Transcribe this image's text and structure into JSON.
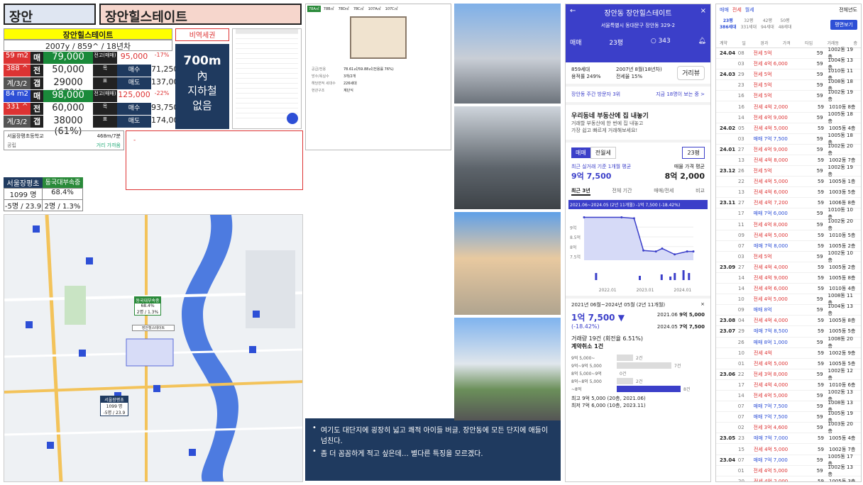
{
  "header": {
    "region": "장안",
    "apt": "장안힐스테이트"
  },
  "card": {
    "name": "장안힐스테이트",
    "meta": "2007y / 859^ / 18년차",
    "tag_label": "비역세권"
  },
  "rows": [
    {
      "a": "59 m2",
      "b": "매",
      "c": "79,000",
      "d": "전고(매매)",
      "e": "95,000",
      "f": "-17%"
    },
    {
      "a": "388 ^",
      "b": "전",
      "c": "50,000",
      "d": "목",
      "e": "매수",
      "f": "71,250"
    },
    {
      "a": "계/3/2",
      "b": "갭",
      "c": "29000 (63%)",
      "d": "표",
      "e": "매도",
      "f": "137,000"
    },
    {
      "a": "84 m2",
      "b": "매",
      "c": "98,000",
      "d": "전고(매매)",
      "e": "125,000",
      "f": "-22%"
    },
    {
      "a": "331 ^",
      "b": "전",
      "c": "60,000",
      "d": "목",
      "e": "매수",
      "f": "93,750"
    },
    {
      "a": "계/3/2",
      "b": "갭",
      "c": "38000 (61%)",
      "d": "표",
      "e": "매도",
      "f": "174,000"
    }
  ],
  "subway": {
    "l1": "700m",
    "l2": "內",
    "l3": "지하철",
    "l4": "없음"
  },
  "school": {
    "name": "서울장평초등학교",
    "dist": "468m/7분",
    "type": "공립",
    "note": "거리 가까움"
  },
  "stats": {
    "h1": "서울장평초",
    "h2": "동국대부속중",
    "v1": "1099 명",
    "v2": "68.4%",
    "v3": "-5명 / 23.9",
    "v4": "2명 / 1.3%"
  },
  "map": {
    "b1": "동국대부속중",
    "b1v": "68.4%",
    "b1w": "2명 / 1.3%",
    "b2": "장안힐스테이트",
    "b3": "서울장평초",
    "b3v": "1099 명",
    "b3w": "-5명 / 23.9"
  },
  "plan": {
    "tabs": [
      "78A㎡",
      "78B㎡",
      "78D㎡",
      "78C㎡",
      "107A㎡",
      "107C㎡"
    ],
    "info": [
      [
        "공급/전용",
        "78.61㎡/59.88㎡(전용률 76%)"
      ],
      [
        "방수/욕실수",
        "3개/2개"
      ],
      [
        "해당면적 세대수",
        "226세대"
      ],
      [
        "현관구조",
        "계단식"
      ]
    ]
  },
  "notes": {
    "n1": "여기도 대단지에 굉장히 넓고 쾌적 아이들 버글. 장안동에 모든 단지에 애들이 넘친다.",
    "n2": "좀 더 꼼꼼하게 적고 싶은데… 별다른 특징을 모르겠다."
  },
  "mobile": {
    "title": "장안동 장안힐스테이트",
    "addr": "서울특별시 동대문구 장안동 329-2",
    "deal": "매매",
    "size": "23평",
    "comments": "343",
    "info1": "859세대",
    "info2": "2007년 8월(18년차)",
    "info3": "용적률 249%",
    "info4": "전세율 15%",
    "route": "거리뷰",
    "visit": "장안동 주간 방문자 3위",
    "visit_link": "지금 18명이 보는 중 >",
    "banner1": "우리동네 부동산에 집 내놓기",
    "banner2": "거래할 부동산에 한 번에 집 내놓고",
    "banner3": "가장 쉽고 빠르게 거래해보세요!",
    "tab1": "매매",
    "tab2": "전월세",
    "pyeong": "23평",
    "recent": "최근 실거래 기준 1개월 평균",
    "recentv": "9억 7,500",
    "ask": "매물 가격 평균",
    "askv": "8억 2,000",
    "t1": "최근 3년",
    "t2": "전체 기간",
    "t3": "매매/전세",
    "t4": "비교",
    "chart_hdr": "2021.06~2024.05 (2년 11개월) -1억 7,500 (-18.42%)",
    "period": "2021년 06월~2024년 05월 (2년 11개월)",
    "diff": "1억 7,500 ▼",
    "pct": "(-18.42%)",
    "d1": "2021.06",
    "d1v": "9억 5,000",
    "d2": "2024.05",
    "d2v": "7억 7,500",
    "vol": "거래량 19건 (회전율 6.51%)",
    "cancel": "계약취소 1건",
    "hi": "최고 9억 5,000 (20층, 2021.06)",
    "lo": "최저 7억 6,000 (10층, 2023.11)"
  },
  "dist": [
    {
      "l": "9억 5,000~",
      "v": "2건",
      "w": 0.25
    },
    {
      "l": "9억~9억 5,000",
      "v": "7건",
      "w": 0.85
    },
    {
      "l": "8억 5,000~9억",
      "v": "0건",
      "w": 0
    },
    {
      "l": "8억~8억 5,000",
      "v": "2건",
      "w": 0.25
    },
    {
      "l": "~8억",
      "v": "8건",
      "w": 1
    }
  ],
  "list": {
    "tabs": [
      "매매",
      "전세",
      "월세"
    ],
    "year": "전체년도",
    "sizes": [
      [
        "23평",
        "386세대"
      ],
      [
        "32평",
        "331세대"
      ],
      [
        "42평",
        "94세대"
      ],
      [
        "50평",
        "48세대"
      ]
    ],
    "btn": "평면보기",
    "cols": [
      "계약",
      "일",
      "경과",
      "가격",
      "타입",
      "거래동",
      "층"
    ],
    "rows": [
      [
        "24.04",
        "08",
        "전세 5억",
        "59",
        "1002동 19층"
      ],
      [
        "",
        "03",
        "전세 4억 6,000",
        "59",
        "1004동 13층"
      ],
      [
        "24.03",
        "29",
        "전세 5억",
        "59",
        "1010동 11층"
      ],
      [
        "",
        "23",
        "전세 5억",
        "59",
        "1008동 18층"
      ],
      [
        "",
        "16",
        "전세 5억",
        "59",
        "1002동 19층"
      ],
      [
        "",
        "16",
        "전세 4억 2,000",
        "59",
        "1010동 8층"
      ],
      [
        "",
        "14",
        "전세 4억 9,000",
        "59",
        "1005동 18층"
      ],
      [
        "24.02",
        "05",
        "전세 4억 5,000",
        "59",
        "1005동 4층"
      ],
      [
        "",
        "03",
        "매매 7억 7,500",
        "59",
        "1005동 18층"
      ],
      [
        "24.01",
        "27",
        "전세 4억 9,000",
        "59",
        "1002동 20층"
      ],
      [
        "",
        "13",
        "전세 4억 8,000",
        "59",
        "1002동 7층"
      ],
      [
        "23.12",
        "26",
        "전세 5억",
        "59",
        "1002동 19층"
      ],
      [
        "",
        "22",
        "전세 4억 5,000",
        "59",
        "1005동 1층"
      ],
      [
        "",
        "13",
        "전세 4억 6,000",
        "59",
        "1003동 5층"
      ],
      [
        "23.11",
        "27",
        "전세 4억 7,200",
        "59",
        "1006동 8층"
      ],
      [
        "",
        "17",
        "매매 7억 6,000",
        "59",
        "1010동 10층"
      ],
      [
        "",
        "11",
        "전세 4억 8,000",
        "59",
        "1002동 20층"
      ],
      [
        "",
        "09",
        "전세 4억 5,000",
        "59",
        "1010동 5층"
      ],
      [
        "",
        "07",
        "매매 7억 8,000",
        "59",
        "1005동 2층"
      ],
      [
        "",
        "03",
        "전세 5억",
        "59",
        "1002동 10층"
      ],
      [
        "23.09",
        "27",
        "전세 4억 4,000",
        "59",
        "1005동 2층"
      ],
      [
        "",
        "14",
        "전세 4억 9,000",
        "59",
        "1005동 8층"
      ],
      [
        "",
        "14",
        "전세 4억 6,000",
        "59",
        "1010동 4층"
      ],
      [
        "",
        "10",
        "전세 4억 5,000",
        "59",
        "1008동 11층"
      ],
      [
        "",
        "09",
        "매매 8억",
        "59",
        "1004동 13층"
      ],
      [
        "23.08",
        "04",
        "전세 4억 4,000",
        "59",
        "1005동 8층"
      ],
      [
        "23.07",
        "29",
        "매매 7억 8,500",
        "59",
        "1005동 5층"
      ],
      [
        "",
        "26",
        "매매 8억 1,000",
        "59",
        "1008동 20층"
      ],
      [
        "",
        "10",
        "전세 4억",
        "59",
        "1002동 9층"
      ],
      [
        "",
        "01",
        "전세 4억 5,000",
        "59",
        "1005동 5층"
      ],
      [
        "23.06",
        "22",
        "전세 3억 8,000",
        "59",
        "1002동 12층"
      ],
      [
        "",
        "17",
        "전세 4억 4,000",
        "59",
        "1010동 6층"
      ],
      [
        "",
        "14",
        "전세 4억 5,000",
        "59",
        "1002동 13층"
      ],
      [
        "",
        "07",
        "매매 7억 7,500",
        "59",
        "1008동 13층"
      ],
      [
        "",
        "07",
        "매매 7억 7,500",
        "59",
        "1005동 19층"
      ],
      [
        "",
        "02",
        "전세 3억 4,600",
        "59",
        "1003동 20층"
      ],
      [
        "23.05",
        "23",
        "매매 7억 7,000",
        "59",
        "1005동 4층"
      ],
      [
        "",
        "15",
        "전세 4억 5,000",
        "59",
        "1002동 7층"
      ],
      [
        "23.04",
        "07",
        "매매 7억 7,000",
        "59",
        "1005동 17층"
      ],
      [
        "",
        "01",
        "전세 4억 5,000",
        "59",
        "1002동 13층"
      ],
      [
        "",
        "20",
        "전세 4억 2,000",
        "59",
        "1005동 3층"
      ]
    ]
  },
  "chart_data": {
    "type": "line",
    "title": "",
    "xlabel": "",
    "ylabel": "",
    "x_ticks": [
      "2022.01",
      "2023.01",
      "2024.01"
    ],
    "y_ticks": [
      "9억",
      "8.5억",
      "8억",
      "7.5억"
    ],
    "series": [
      {
        "values": [
          {
            "x": "2021.06",
            "y": 9.5
          },
          {
            "x": "2022.06",
            "y": 9.5
          },
          {
            "x": "2022.10",
            "y": 9.45
          },
          {
            "x": "2023.01",
            "y": 7.8
          },
          {
            "x": "2023.05",
            "y": 7.75
          },
          {
            "x": "2023.07",
            "y": 7.9
          },
          {
            "x": "2023.11",
            "y": 7.6
          },
          {
            "x": "2024.03",
            "y": 7.75
          },
          {
            "x": "2024.05",
            "y": 7.75
          }
        ]
      }
    ],
    "ylim": [
      7.3,
      9.7
    ]
  }
}
